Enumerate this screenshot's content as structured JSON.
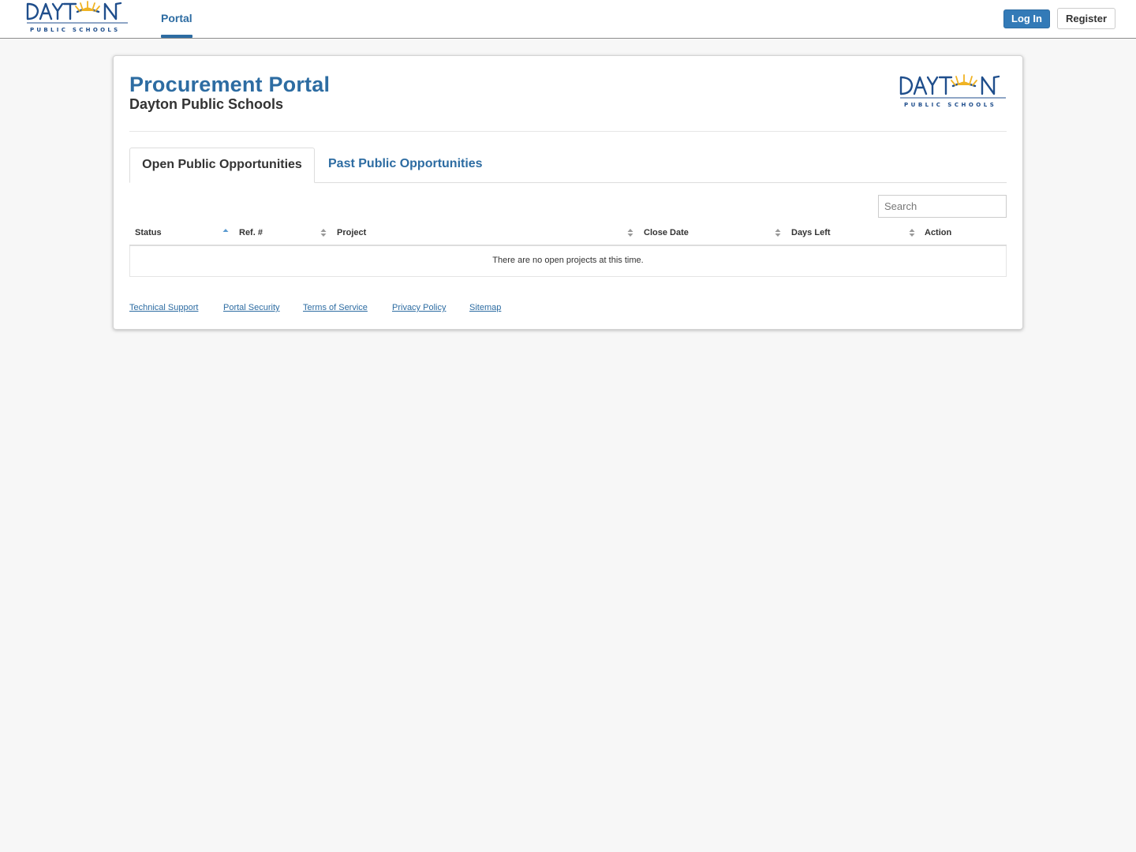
{
  "brand": {
    "logo_word": "DAYT N",
    "logo_tagline": "PUBLIC SCHOOLS"
  },
  "nav": {
    "portal_label": "Portal",
    "login_label": "Log In",
    "register_label": "Register"
  },
  "header": {
    "title": "Procurement Portal",
    "subtitle": "Dayton Public Schools"
  },
  "tabs": [
    {
      "label": "Open Public Opportunities",
      "active": true
    },
    {
      "label": "Past Public Opportunities",
      "active": false
    }
  ],
  "search": {
    "placeholder": "Search",
    "value": ""
  },
  "table": {
    "columns": [
      {
        "label": "Status",
        "sort": "ascending"
      },
      {
        "label": "Ref. #",
        "sort": "none"
      },
      {
        "label": "Project",
        "sort": "none"
      },
      {
        "label": "Close Date",
        "sort": "none"
      },
      {
        "label": "Days Left",
        "sort": "none"
      },
      {
        "label": "Action",
        "sort": "unsortable"
      }
    ],
    "empty_message": "There are no open projects at this time."
  },
  "footer": {
    "links": [
      "Technical Support",
      "Portal Security",
      "Terms of Service",
      "Privacy Policy",
      "Sitemap"
    ]
  },
  "colors": {
    "brand_blue": "#2d6ca2",
    "button_blue": "#337ab7",
    "logo_navy": "#1f4e8c",
    "logo_sun": "#f0b323",
    "page_bg": "#f7f7f7"
  }
}
